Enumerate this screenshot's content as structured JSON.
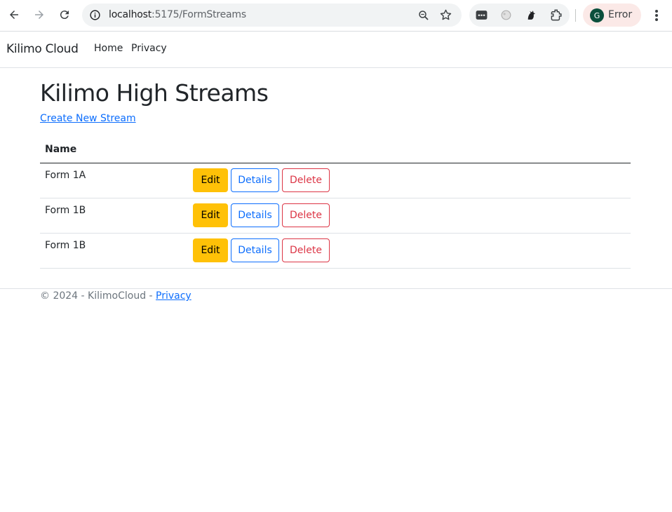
{
  "browser": {
    "url_host": "localhost",
    "url_path": ":5175/FormStreams",
    "profile_initial": "G",
    "profile_label": "Error",
    "accent_color": "#0b4f3c",
    "icons": [
      "back-icon",
      "forward-icon",
      "reload-icon",
      "site-info-icon",
      "zoom-icon",
      "bookmark-star-icon",
      "extension-icon",
      "menu-icon"
    ]
  },
  "navbar": {
    "brand": "Kilimo Cloud",
    "links": [
      {
        "label": "Home"
      },
      {
        "label": "Privacy"
      }
    ]
  },
  "main": {
    "title": "Kilimo High Streams",
    "create_link": "Create New Stream",
    "table": {
      "header_name": "Name",
      "rows": [
        {
          "name": "Form 1A",
          "edit": "Edit",
          "details": "Details",
          "delete": "Delete"
        },
        {
          "name": "Form 1B",
          "edit": "Edit",
          "details": "Details",
          "delete": "Delete"
        },
        {
          "name": "Form 1B",
          "edit": "Edit",
          "details": "Details",
          "delete": "Delete"
        }
      ]
    }
  },
  "footer": {
    "text": "© 2024 - KilimoCloud - ",
    "privacy_link": "Privacy"
  },
  "colors": {
    "primary": "#0d6efd",
    "warning": "#ffc107",
    "danger": "#dc3545",
    "muted": "#6c757d"
  }
}
